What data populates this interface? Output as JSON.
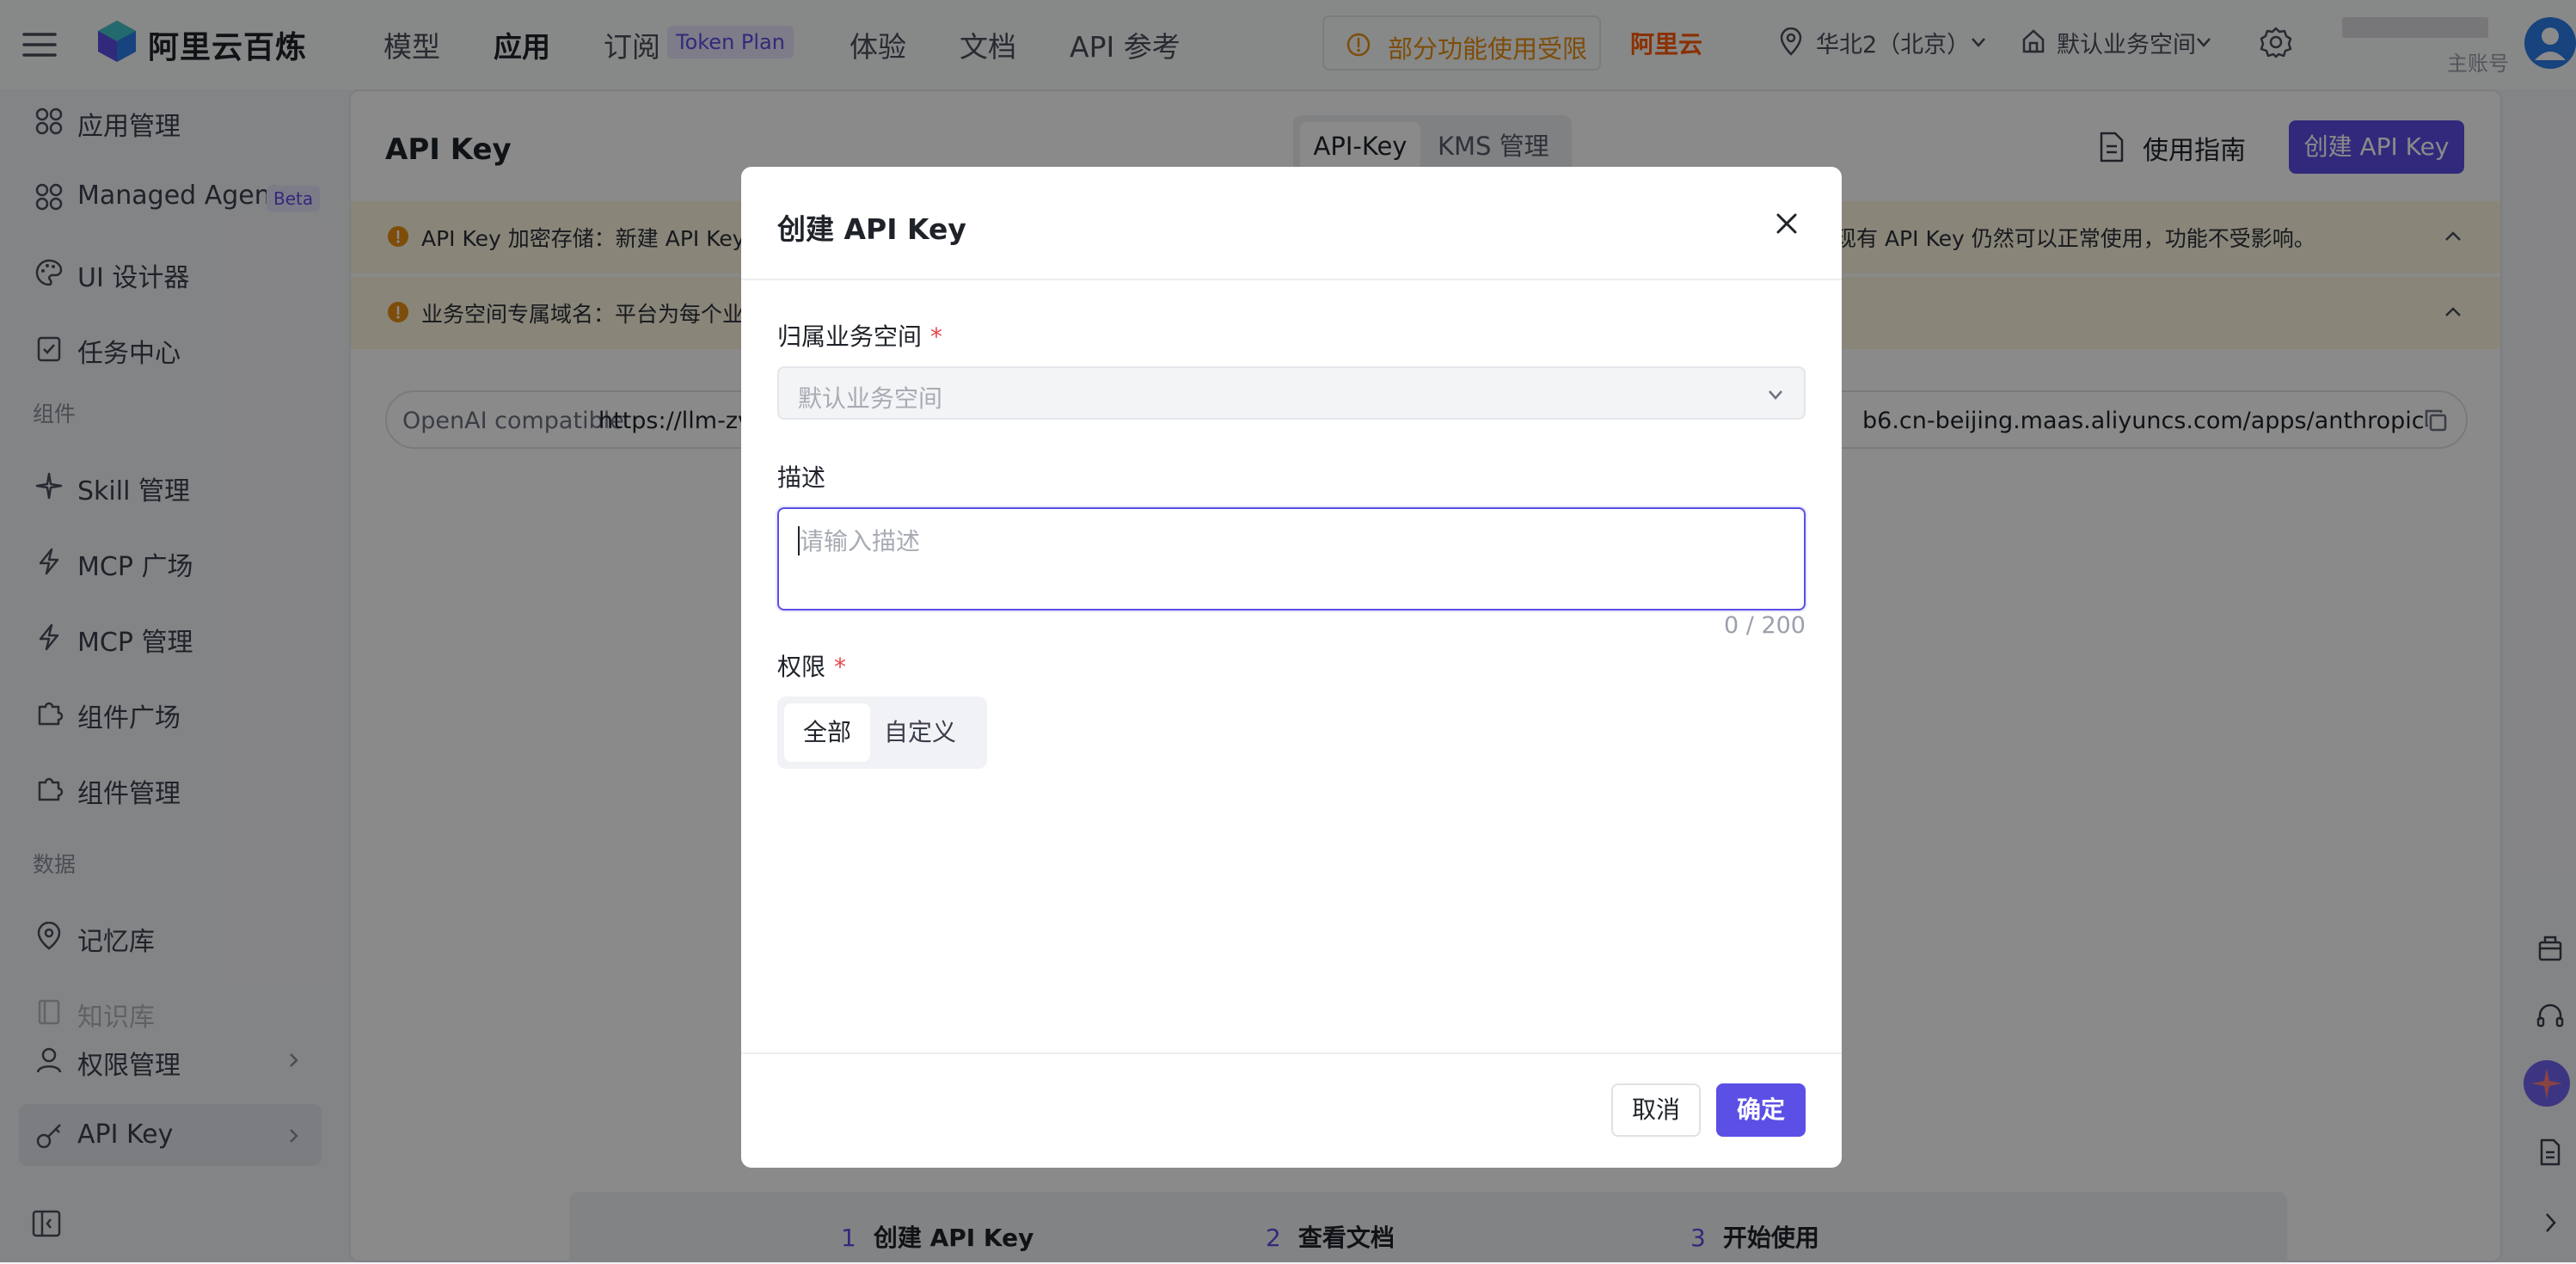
{
  "brand": {
    "name": "阿里云百炼"
  },
  "nav": {
    "items": [
      {
        "label": "模型",
        "active": false
      },
      {
        "label": "应用",
        "active": true
      },
      {
        "label": "订阅",
        "active": false
      },
      {
        "label": "体验",
        "active": false
      },
      {
        "label": "文档",
        "active": false
      },
      {
        "label": "API 参考",
        "active": false
      }
    ],
    "subscription_badge": "Token Plan"
  },
  "topbar": {
    "limited_notice": "部分功能使用受限",
    "aliyun_logo": "阿里云",
    "region": "华北2（北京）",
    "workspace": "默认业务空间",
    "account_role": "主账号"
  },
  "sidebar": {
    "items": [
      {
        "label": "应用管理",
        "icon": "apps-icon"
      },
      {
        "label": "Managed Agents",
        "badge": "Beta",
        "icon": "apps-icon"
      },
      {
        "label": "UI 设计器",
        "icon": "palette-icon"
      },
      {
        "label": "任务中心",
        "icon": "task-icon"
      },
      {
        "label": "Skill 管理",
        "icon": "sparkle-icon"
      },
      {
        "label": "MCP 广场",
        "icon": "lightning-icon"
      },
      {
        "label": "MCP 管理",
        "icon": "lightning-icon"
      },
      {
        "label": "组件广场",
        "icon": "puzzle-icon"
      },
      {
        "label": "组件管理",
        "icon": "puzzle-icon"
      },
      {
        "label": "记忆库",
        "icon": "memory-icon"
      },
      {
        "label": "知识库",
        "icon": "book-icon"
      },
      {
        "label": "权限管理",
        "icon": "user-icon"
      },
      {
        "label": "API Key",
        "icon": "key-icon",
        "selected": true
      }
    ],
    "sections": [
      "组件",
      "数据"
    ]
  },
  "page": {
    "title": "API Key",
    "tabs": [
      "API-Key",
      "KMS 管理"
    ],
    "guide_label": "使用指南",
    "create_label": "创建 API Key",
    "banners": [
      {
        "text": "API Key 加密存储：新建 API Key 仅",
        "text_right": "现有 API Key 仍然可以正常使用，功能不受影响。"
      },
      {
        "text": "业务空间专属域名：平台为每个业务"
      }
    ],
    "endpoint": {
      "label": "OpenAI compatible",
      "value_left": "https://llm-zvh",
      "value_right": "b6.cn-beijing.maas.aliyuncs.com/apps/anthropic"
    },
    "steps": [
      {
        "num": "1",
        "label": "创建 API Key"
      },
      {
        "num": "2",
        "label": "查看文档"
      },
      {
        "num": "3",
        "label": "开始使用"
      }
    ]
  },
  "modal": {
    "title": "创建 API Key",
    "workspace_label": "归属业务空间",
    "workspace_value": "默认业务空间",
    "description_label": "描述",
    "description_placeholder": "请输入描述",
    "description_counter": "0 / 200",
    "permission_label": "权限",
    "permission_options": [
      "全部",
      "自定义"
    ],
    "permission_selected": "全部",
    "cancel_label": "取消",
    "ok_label": "确定"
  },
  "colors": {
    "accent": "#5b4fe6",
    "warning": "#e88f12",
    "required": "#e5484d",
    "aliyun": "#ff5a00"
  }
}
